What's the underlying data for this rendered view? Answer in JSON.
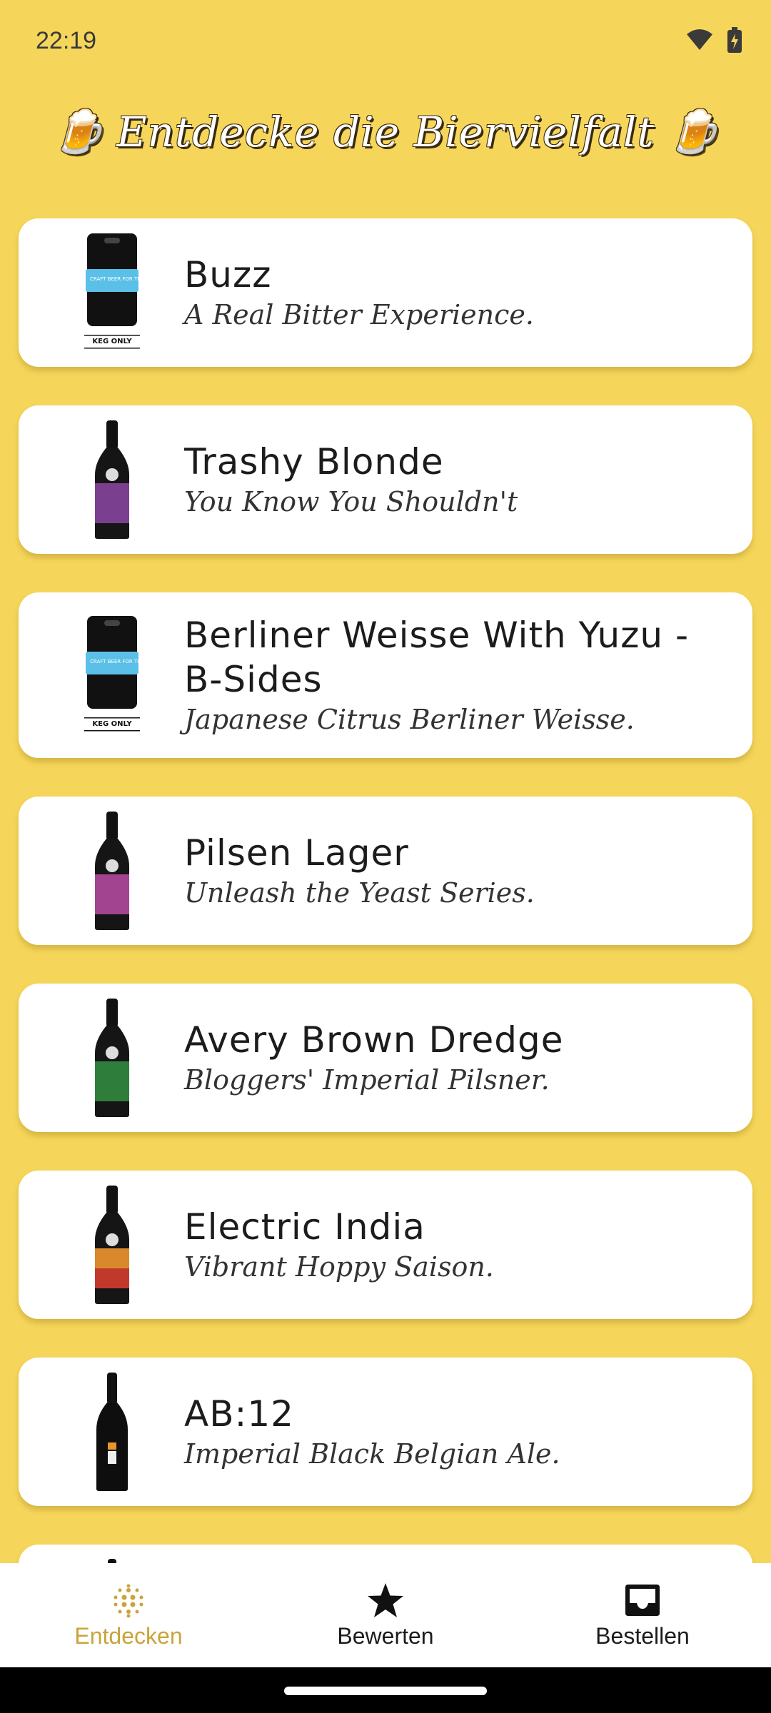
{
  "status": {
    "time": "22:19"
  },
  "title": {
    "text": "Entdecke die Biervielfalt",
    "emoji_left": "🍺",
    "emoji_right": "🍺"
  },
  "beers": [
    {
      "name": "Buzz",
      "tagline": "A Real Bitter Experience.",
      "image": "keg",
      "label_color": "#5BC0E8",
      "keg_label": "KEG ONLY",
      "keg_text": "CRAFT BEER FOR THE PEOPLE"
    },
    {
      "name": "Trashy Blonde",
      "tagline": "You Know You Shouldn't",
      "image": "bottle",
      "label_color": "#7B3F8F"
    },
    {
      "name": "Berliner Weisse With Yuzu - B-Sides",
      "tagline": "Japanese Citrus Berliner Weisse.",
      "image": "keg",
      "label_color": "#5BC0E8",
      "keg_label": "KEG ONLY",
      "keg_text": "CRAFT BEER FOR THE PEOPLE"
    },
    {
      "name": "Pilsen Lager",
      "tagline": "Unleash the Yeast Series.",
      "image": "bottle",
      "label_color": "#A2448F"
    },
    {
      "name": "Avery Brown Dredge",
      "tagline": "Bloggers' Imperial Pilsner.",
      "image": "bottle",
      "label_color": "#2E7D3A"
    },
    {
      "name": "Electric India",
      "tagline": "Vibrant Hoppy Saison.",
      "image": "bottle",
      "label_color": "#D9892B"
    },
    {
      "name": "AB:12",
      "tagline": "Imperial Black Belgian Ale.",
      "image": "tall-bottle",
      "label_color": "#E8962B"
    }
  ],
  "nav": [
    {
      "label": "Entdecken",
      "icon": "discover-dots-icon",
      "active": true
    },
    {
      "label": "Bewerten",
      "icon": "star-icon",
      "active": false
    },
    {
      "label": "Bestellen",
      "icon": "inbox-icon",
      "active": false
    }
  ],
  "colors": {
    "background": "#F6D65A",
    "accent": "#C9A43A",
    "card": "#FFFFFF"
  }
}
